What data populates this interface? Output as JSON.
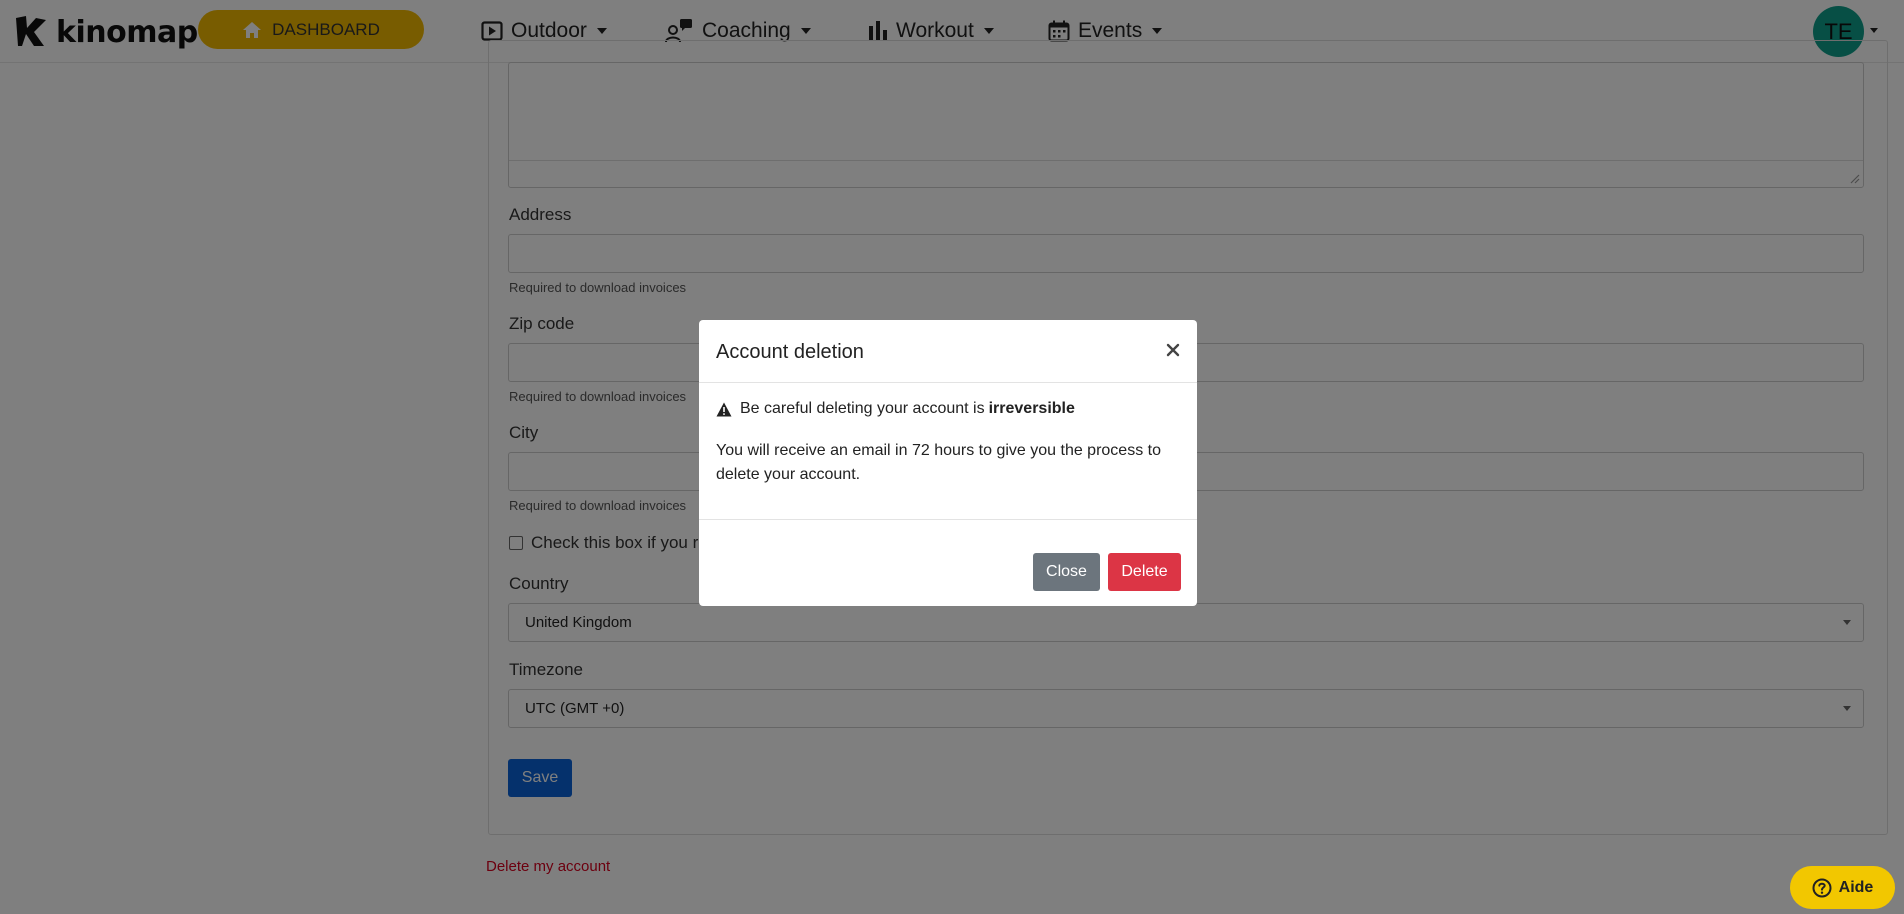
{
  "navbar": {
    "logo_text": "kinomap",
    "dashboard_label": "DASHBOARD",
    "items": [
      {
        "label": "Outdoor",
        "icon": "play-square-icon"
      },
      {
        "label": "Coaching",
        "icon": "user-chat-icon"
      },
      {
        "label": "Workout",
        "icon": "bar-chart-icon"
      },
      {
        "label": "Events",
        "icon": "calendar-icon"
      }
    ],
    "avatar_initials": "TE"
  },
  "form": {
    "address_label": "Address",
    "address_help": "Required to download invoices",
    "zip_label": "Zip code",
    "zip_help": "Required to download invoices",
    "city_label": "City",
    "city_help": "Required to download invoices",
    "checkbox_label": "Check this box if you rep",
    "country_label": "Country",
    "country_value": "United Kingdom",
    "timezone_label": "Timezone",
    "timezone_value": "UTC (GMT +0)",
    "save_label": "Save",
    "delete_link": "Delete my account"
  },
  "modal": {
    "title": "Account deletion",
    "warning_text": "Be careful deleting your account is",
    "warning_strong": "irreversible",
    "body": "You will receive an email in 72 hours to give you the process to delete your account.",
    "close_label": "Close",
    "delete_label": "Delete"
  },
  "help_widget": {
    "label": "Aide"
  },
  "colors": {
    "brand_yellow": "#f1b800",
    "primary": "#0a63d8",
    "danger": "#dc3545",
    "secondary": "#6c757d",
    "avatar": "#0f9e8a"
  }
}
